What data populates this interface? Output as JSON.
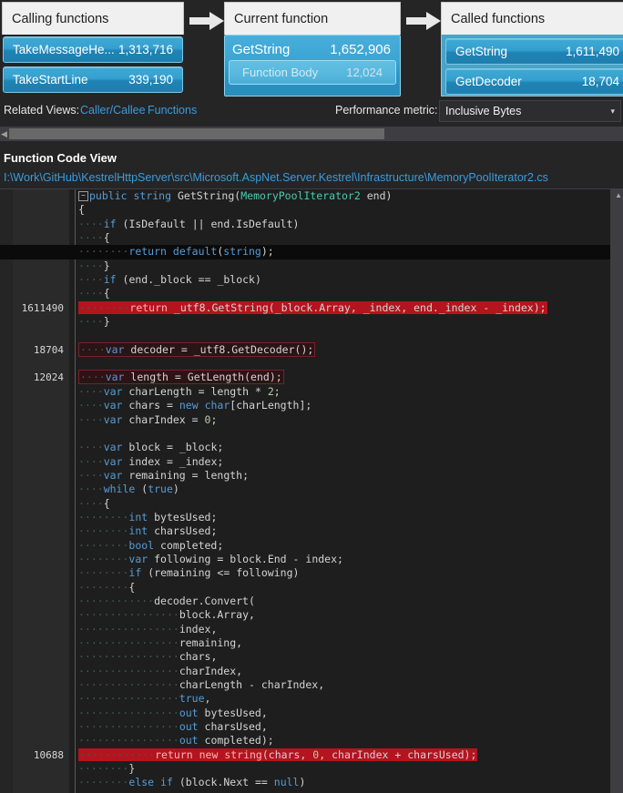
{
  "callgraph": {
    "calling": {
      "title": "Calling functions",
      "items": [
        {
          "name": "TakeMessageHe...",
          "value": "1,313,716"
        },
        {
          "name": "TakeStartLine",
          "value": "339,190"
        }
      ]
    },
    "current": {
      "title": "Current function",
      "name": "GetString",
      "value": "1,652,906",
      "body_label": "Function Body",
      "body_value": "12,024"
    },
    "called": {
      "title": "Called functions",
      "items": [
        {
          "name": "GetString",
          "value": "1,611,490"
        },
        {
          "name": "GetDecoder",
          "value": "18,704"
        }
      ]
    }
  },
  "related_views": {
    "label": "Related Views:",
    "links": [
      "Caller/Callee",
      "Functions"
    ]
  },
  "performance_metric": {
    "label": "Performance metric:",
    "value": "Inclusive Bytes",
    "caret": "▾"
  },
  "code_view": {
    "title": "Function Code View",
    "path": "I:\\Work\\GitHub\\KestrelHttpServer\\src\\Microsoft.AspNet.Server.Kestrel\\Infrastructure\\MemoryPoolIterator2.cs"
  },
  "colors": {
    "accent_blue": "#3b9bdc",
    "box_blue": "#2b93c4",
    "hot_red": "#b4141e",
    "keyword": "#569cd6",
    "type": "#4ec9b0",
    "plain": "#d4d4d4",
    "editor_bg": "#1e1e1e"
  },
  "code_lines": [
    {
      "cost": "",
      "text": "public string GetString(MemoryPoolIterator2 end)"
    },
    {
      "cost": "",
      "text": "{"
    },
    {
      "cost": "",
      "text": "    if (IsDefault || end.IsDefault)"
    },
    {
      "cost": "",
      "text": "    {"
    },
    {
      "cost": "",
      "text": "        return default(string);"
    },
    {
      "cost": "",
      "text": "    }"
    },
    {
      "cost": "",
      "text": "    if (end._block == _block)"
    },
    {
      "cost": "",
      "text": "    {"
    },
    {
      "cost": "1611490",
      "text": "        return _utf8.GetString(_block.Array, _index, end._index - _index);"
    },
    {
      "cost": "",
      "text": "    }"
    },
    {
      "cost": "",
      "text": ""
    },
    {
      "cost": "18704",
      "text": "    var decoder = _utf8.GetDecoder();"
    },
    {
      "cost": "",
      "text": ""
    },
    {
      "cost": "12024",
      "text": "    var length = GetLength(end);"
    },
    {
      "cost": "",
      "text": "    var charLength = length * 2;"
    },
    {
      "cost": "",
      "text": "    var chars = new char[charLength];"
    },
    {
      "cost": "",
      "text": "    var charIndex = 0;"
    },
    {
      "cost": "",
      "text": ""
    },
    {
      "cost": "",
      "text": "    var block = _block;"
    },
    {
      "cost": "",
      "text": "    var index = _index;"
    },
    {
      "cost": "",
      "text": "    var remaining = length;"
    },
    {
      "cost": "",
      "text": "    while (true)"
    },
    {
      "cost": "",
      "text": "    {"
    },
    {
      "cost": "",
      "text": "        int bytesUsed;"
    },
    {
      "cost": "",
      "text": "        int charsUsed;"
    },
    {
      "cost": "",
      "text": "        bool completed;"
    },
    {
      "cost": "",
      "text": "        var following = block.End - index;"
    },
    {
      "cost": "",
      "text": "        if (remaining <= following)"
    },
    {
      "cost": "",
      "text": "        {"
    },
    {
      "cost": "",
      "text": "            decoder.Convert("
    },
    {
      "cost": "",
      "text": "                block.Array,"
    },
    {
      "cost": "",
      "text": "                index,"
    },
    {
      "cost": "",
      "text": "                remaining,"
    },
    {
      "cost": "",
      "text": "                chars,"
    },
    {
      "cost": "",
      "text": "                charIndex,"
    },
    {
      "cost": "",
      "text": "                charLength - charIndex,"
    },
    {
      "cost": "",
      "text": "                true,"
    },
    {
      "cost": "",
      "text": "                out bytesUsed,"
    },
    {
      "cost": "",
      "text": "                out charsUsed,"
    },
    {
      "cost": "",
      "text": "                out completed);"
    },
    {
      "cost": "10688",
      "text": "            return new string(chars, 0, charIndex + charsUsed);"
    },
    {
      "cost": "",
      "text": "        }"
    },
    {
      "cost": "",
      "text": "        else if (block.Next == null)"
    }
  ]
}
